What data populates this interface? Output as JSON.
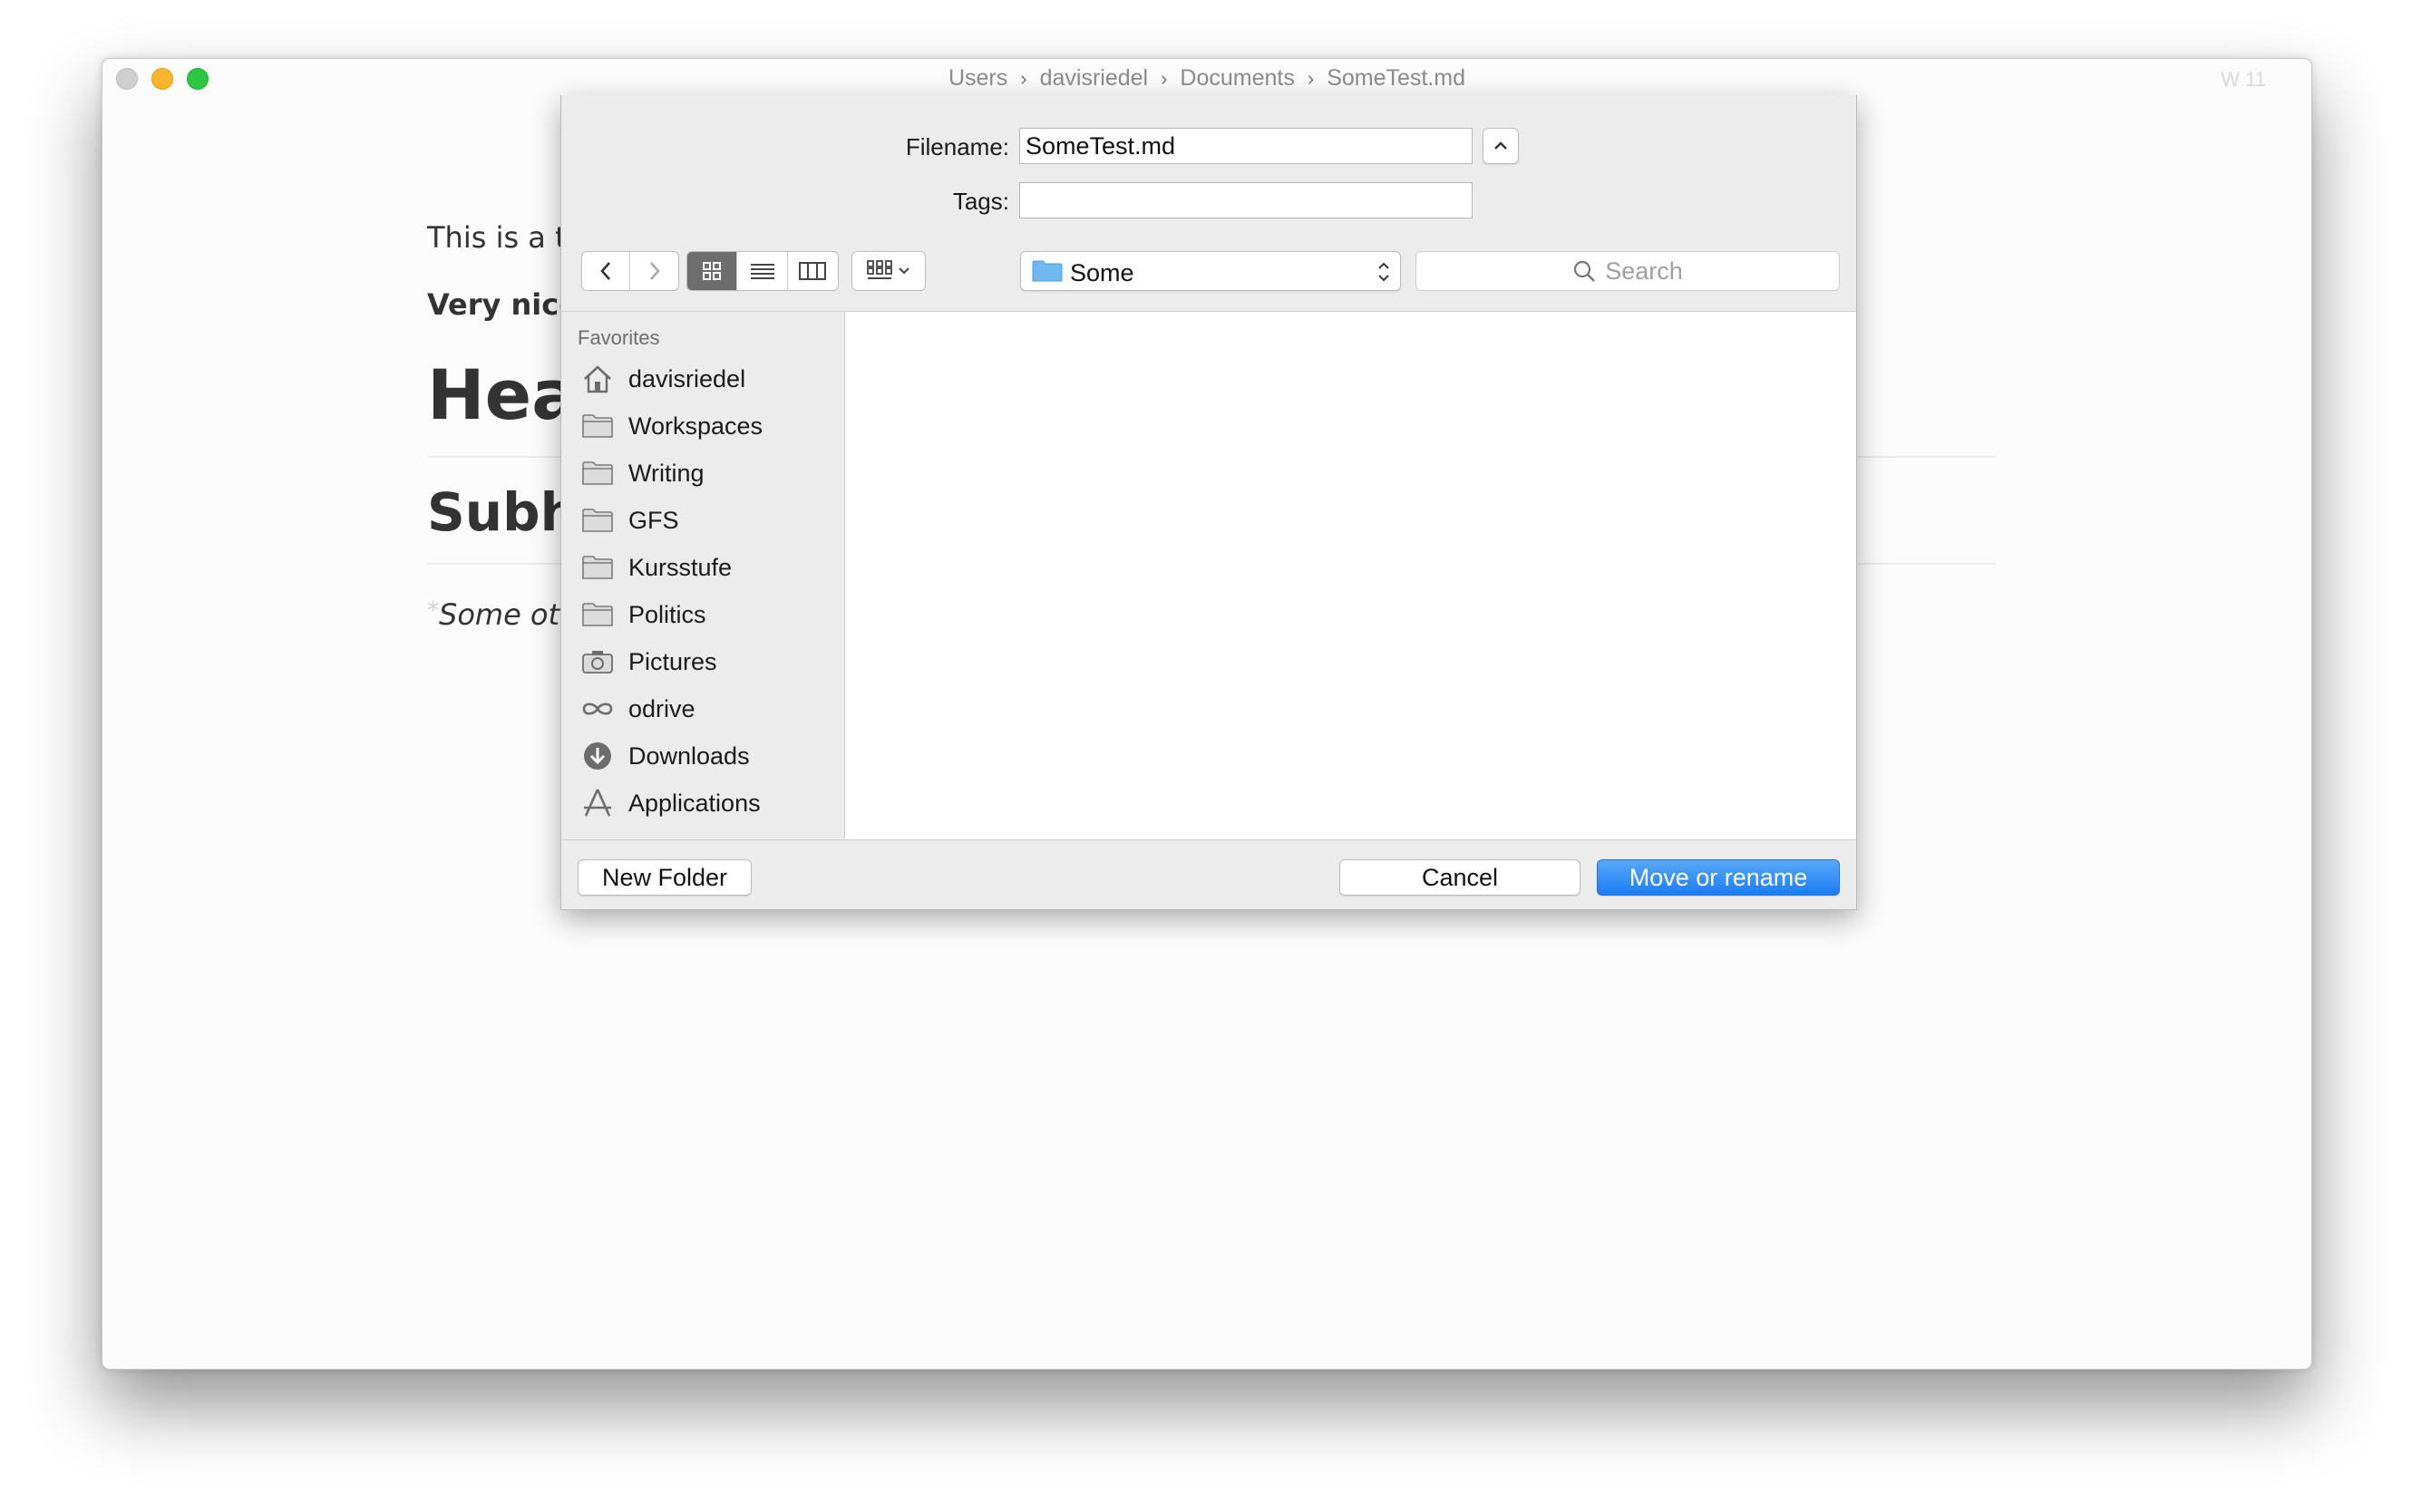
{
  "window": {
    "breadcrumb": [
      "Users",
      "davisriedel",
      "Documents",
      "SomeTest.md"
    ],
    "breadcrumb_sep": "›",
    "word_count": "W 11"
  },
  "document": {
    "paragraph_1": "This is a te",
    "paragraph_2": "Very nice",
    "heading_1": "Hea",
    "heading_2": "Subh",
    "asterisk": "*",
    "paragraph_3": "Some oth"
  },
  "dialog": {
    "filename_label": "Filename:",
    "filename_value": "SomeTest.md",
    "tags_label": "Tags:",
    "tags_value": "",
    "location": "Some",
    "search_placeholder": "Search",
    "sidebar_heading": "Favorites",
    "favorites": [
      {
        "label": "davisriedel",
        "icon": "home-icon"
      },
      {
        "label": "Workspaces",
        "icon": "folder-icon"
      },
      {
        "label": "Writing",
        "icon": "folder-icon"
      },
      {
        "label": "GFS",
        "icon": "folder-icon"
      },
      {
        "label": "Kursstufe",
        "icon": "folder-icon"
      },
      {
        "label": "Politics",
        "icon": "folder-icon"
      },
      {
        "label": "Pictures",
        "icon": "camera-icon"
      },
      {
        "label": "odrive",
        "icon": "infinity-icon"
      },
      {
        "label": "Downloads",
        "icon": "download-icon"
      },
      {
        "label": "Applications",
        "icon": "applications-icon"
      }
    ],
    "new_folder_label": "New Folder",
    "cancel_label": "Cancel",
    "confirm_label": "Move or rename"
  },
  "colors": {
    "accent": "#1b7cf2",
    "folder_blue": "#6fb8f0"
  }
}
